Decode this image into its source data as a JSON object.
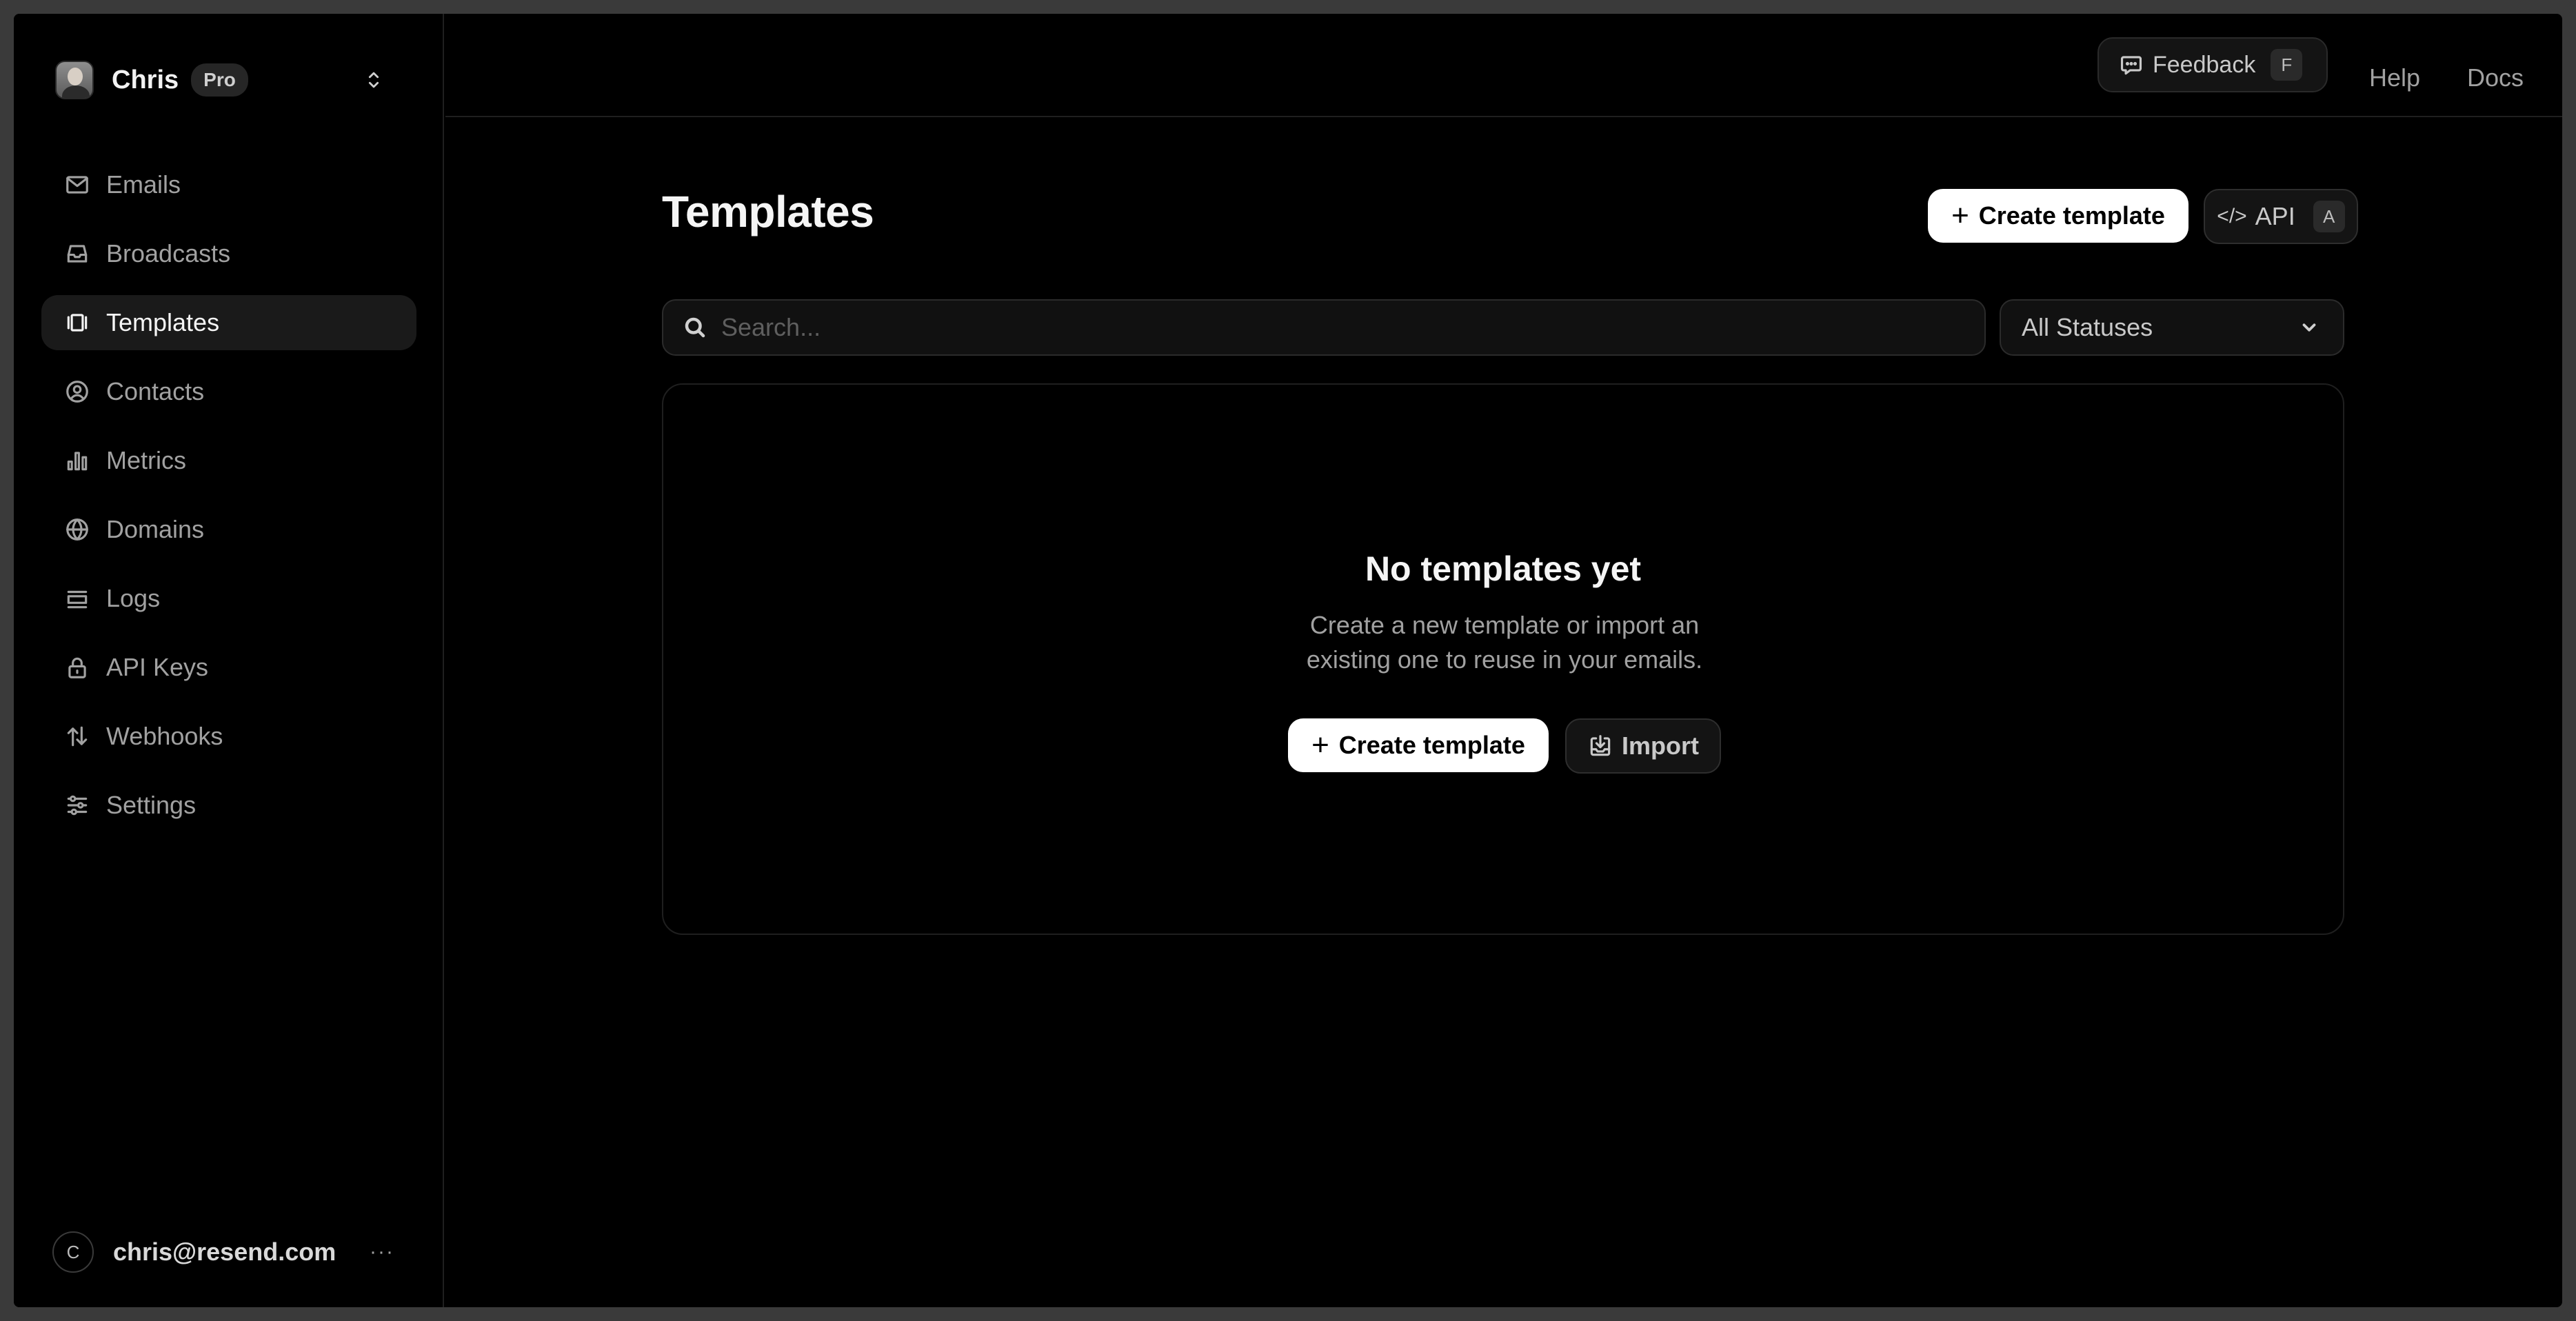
{
  "team": {
    "name": "Chris",
    "plan": "Pro"
  },
  "nav": [
    {
      "label": "Emails",
      "icon": "mail-icon"
    },
    {
      "label": "Broadcasts",
      "icon": "inbox-icon"
    },
    {
      "label": "Templates",
      "icon": "templates-icon",
      "active": true
    },
    {
      "label": "Contacts",
      "icon": "contact-icon"
    },
    {
      "label": "Metrics",
      "icon": "bar-chart-icon"
    },
    {
      "label": "Domains",
      "icon": "globe-icon"
    },
    {
      "label": "Logs",
      "icon": "logs-icon"
    },
    {
      "label": "API Keys",
      "icon": "lock-icon"
    },
    {
      "label": "Webhooks",
      "icon": "arrows-icon"
    },
    {
      "label": "Settings",
      "icon": "sliders-icon"
    }
  ],
  "account": {
    "initial": "C",
    "email": "chris@resend.com",
    "more": "···"
  },
  "header": {
    "feedback_label": "Feedback",
    "feedback_key": "F",
    "help_label": "Help",
    "docs_label": "Docs"
  },
  "page": {
    "title": "Templates",
    "create_label": "Create template",
    "api_label": "API",
    "api_key": "A"
  },
  "search": {
    "placeholder": "Search..."
  },
  "filter": {
    "selected": "All Statuses"
  },
  "empty_state": {
    "title": "No templates yet",
    "description": "Create a new template or import an existing one to reuse in your emails.",
    "create_label": "Create template",
    "import_label": "Import"
  },
  "colors": {
    "background": "#000000",
    "accent": "#ffffff",
    "muted_text": "#a1a1a1"
  }
}
